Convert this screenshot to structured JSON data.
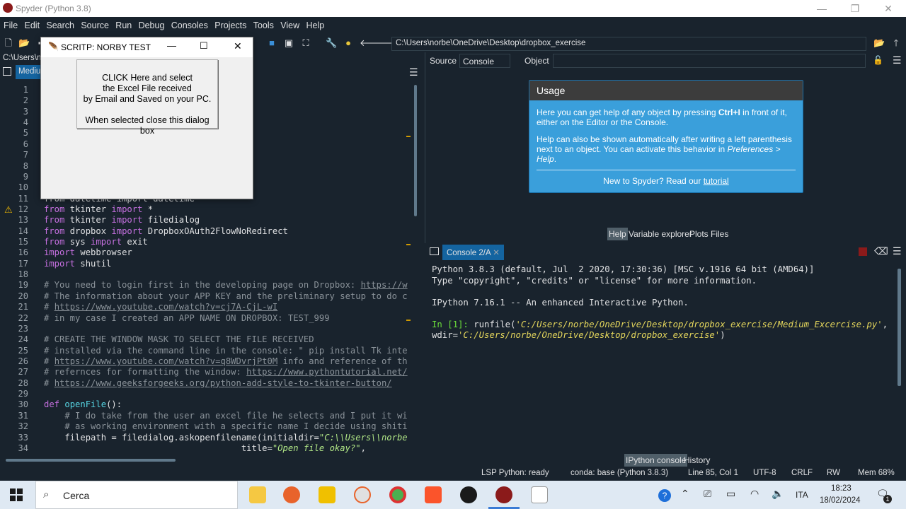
{
  "window": {
    "title": "Spyder (Python 3.8)"
  },
  "menu": [
    "File",
    "Edit",
    "Search",
    "Source",
    "Run",
    "Debug",
    "Consoles",
    "Projects",
    "Tools",
    "View",
    "Help"
  ],
  "toolbar": {
    "path": "C:\\Users\\norbe\\OneDrive\\Desktop\\dropbox_exercise"
  },
  "editor": {
    "filetab_path": "C:\\Users\\n",
    "tab_label": "Mediu",
    "line_numbers": [
      "1",
      "2",
      "3",
      "4",
      "5",
      "6",
      "7",
      "8",
      "9",
      "10",
      "11",
      "12",
      "13",
      "14",
      "15",
      "16",
      "17",
      "18",
      "19",
      "20",
      "21",
      "22",
      "23",
      "24",
      "25",
      "26",
      "27",
      "28",
      "29",
      "30",
      "31",
      "32",
      "33",
      "34"
    ],
    "lines": {
      "l11": "from datetime import datetime",
      "l12a": "from",
      "l12b": " tkinter ",
      "l12c": "import",
      "l12d": " *",
      "l13a": "from",
      "l13b": " tkinter ",
      "l13c": "import",
      "l13d": " filedialog",
      "l14a": "from",
      "l14b": " dropbox ",
      "l14c": "import",
      "l14d": " DropboxOAuth2FlowNoRedirect",
      "l15a": "from",
      "l15b": " sys ",
      "l15c": "import",
      "l15d": " exit",
      "l16a": "import",
      "l16b": " webbrowser",
      "l17a": "import",
      "l17b": " shutil",
      "l19a": "# You need to login first in the developing page on Dropbox: ",
      "l19b": "https://w",
      "l20": "# The information about your APP KEY and the preliminary setup to do c",
      "l21a": "# ",
      "l21b": "https://www.youtube.com/watch?v=cj7A-CjL-wI",
      "l22": "# in my case I created an APP NAME ON DROPBOX: TEST_999",
      "l24": "# CREATE THE WINDOW MASK TO SELECT THE FILE RECEIVED",
      "l25": "# installed via the command line in the console: \" pip install Tk inte",
      "l26a": "# ",
      "l26b": "https://www.youtube.com/watch?v=q8WDvrjPt0M",
      "l26c": " info and reference of th",
      "l27a": "# refernces for formatting the window: ",
      "l27b": "https://www.pythontutorial.net/",
      "l28a": "# ",
      "l28b": "https://www.geeksforgeeks.org/python-add-style-to-tkinter-button/",
      "l30a": "def",
      "l30b": "openFile",
      "l30c": "():",
      "l31": "    # I do take from the user an excel file he selects and I put it wi",
      "l32": "    # as working environment with a specific name I decide using shiti",
      "l33a": "    filepath = filedialog.askopenfilename(initialdir=",
      "l33b": "\"C:\\\\Users\\\\norbe",
      "l34a": "                                      title=",
      "l34b": "\"Open file okay?\"",
      "l34c": ","
    }
  },
  "help": {
    "source_label": "Source",
    "source_value": "Console",
    "object_label": "Object",
    "usage_title": "Usage",
    "p1a": "Here you can get help of any object by pressing ",
    "p1b": "Ctrl+I",
    "p1c": " in front of it, either on the Editor or the Console.",
    "p2a": "Help can also be shown automatically after writing a left parenthesis next to an object. You can activate this behavior in ",
    "p2b": "Preferences > Help",
    "p2c": ".",
    "new_a": "New to Spyder? Read our ",
    "new_b": "tutorial",
    "tabs": [
      "Help",
      "Variable explorer",
      "Plots",
      "Files"
    ]
  },
  "console": {
    "tab": "Console 2/A",
    "line1": "Python 3.8.3 (default, Jul  2 2020, 17:30:36) [MSC v.1916 64 bit (AMD64)]",
    "line2": "Type \"copyright\", \"credits\" or \"license\" for more information.",
    "line3": "IPython 7.16.1 -- An enhanced Interactive Python.",
    "prompt": "In [1]: ",
    "cmd_a": "runfile(",
    "cmd_b": "'C:/Users/norbe/OneDrive/Desktop/dropbox_exercise/Medium_Excercise.py'",
    "cmd_c": ",",
    "cmd_d": "wdir=",
    "cmd_e": "'C:/Users/norbe/OneDrive/Desktop/dropbox_exercise'",
    "cmd_f": ")",
    "tabs": [
      "IPython console",
      "History"
    ]
  },
  "status": {
    "lsp": "LSP Python: ready",
    "conda": "conda: base (Python 3.8.3)",
    "pos": "Line 85, Col 1",
    "enc": "UTF-8",
    "eol": "CRLF",
    "rw": "RW",
    "mem": "Mem 68%"
  },
  "dialog": {
    "title": "SCRITP: NORBY TEST",
    "btn_l1": "CLICK Here and select",
    "btn_l2": "the Excel File received",
    "btn_l3": "by Email and Saved on your PC.",
    "btn_l4": "When selected close this dialog box"
  },
  "taskbar": {
    "search": "Cerca",
    "lang": "ITA",
    "time": "18:23",
    "date": "18/02/2024",
    "notif": "1"
  }
}
